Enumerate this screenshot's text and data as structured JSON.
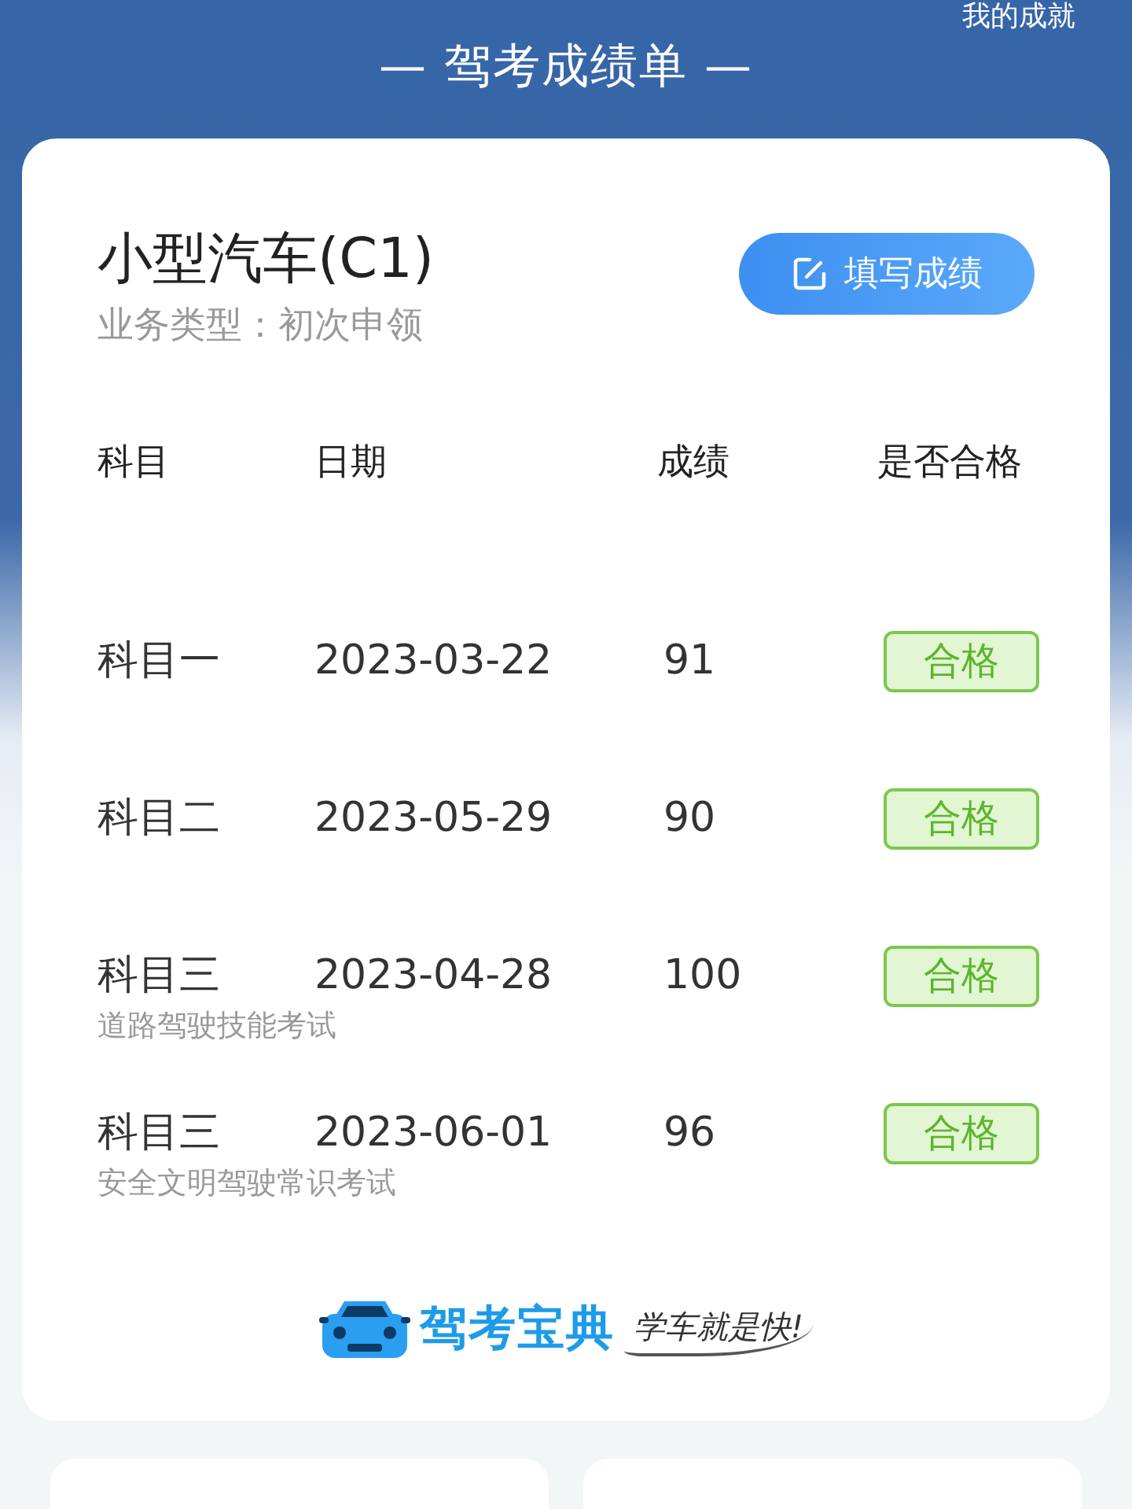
{
  "header": {
    "corner_link": "我的成就",
    "title": "— 驾考成绩单 —"
  },
  "card": {
    "vehicle": "小型汽车(C1)",
    "business_type": "业务类型：初次申领",
    "fill_button": "填写成绩",
    "columns": [
      "科目",
      "日期",
      "成绩",
      "是否合格"
    ],
    "rows": [
      {
        "subject": "科目一",
        "date": "2023-03-22",
        "score": "91",
        "result": "合格",
        "passed": true
      },
      {
        "subject": "科目二",
        "date": "2023-05-29",
        "score": "90",
        "result": "合格",
        "passed": true
      },
      {
        "subject": "科目三",
        "note": "道路驾驶技能考试",
        "date": "2023-04-28",
        "score": "100",
        "result": "合格",
        "passed": true
      },
      {
        "subject": "科目三",
        "note": "安全文明驾驶常识考试",
        "date": "2023-06-01",
        "score": "96",
        "result": "合格",
        "passed": true
      }
    ],
    "brand": {
      "name": "驾考宝典",
      "slogan": "学车就是快!"
    }
  }
}
